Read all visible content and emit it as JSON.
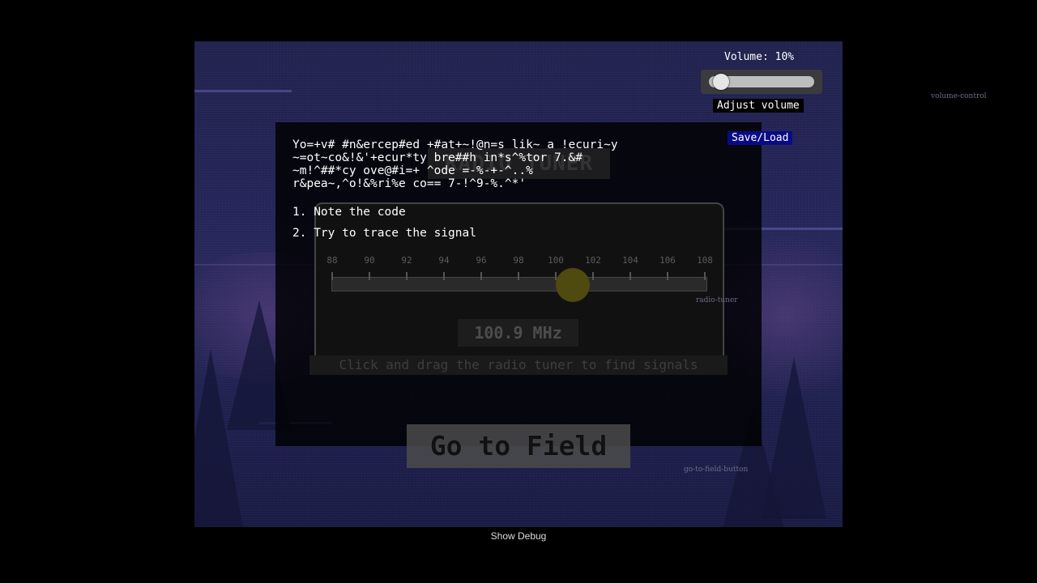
{
  "volume": {
    "label": "Volume: 10%",
    "level_percent": 10,
    "adjust_label": "Adjust volume",
    "debug_name": "volume-control"
  },
  "menu": {
    "save_load_label": "Save/Load"
  },
  "dialog": {
    "message": "Yo=+v# #n&ercep#ed +#at+~!@n=s lik~ a !ecuri~y\n~=ot~co&!&'+ecur*ty bre##h in*s^%tor 7.&#\n~m!^##*cy ove@#i=+ ^ode =-%-+-^..%\nr&pea~,^o!&%ri%e co== 7-!^9-%.^*'",
    "choices": [
      "1. Note the code",
      "2. Try to trace the signal"
    ]
  },
  "tuner": {
    "title": "RADIO TUNER",
    "tick_labels": [
      "88",
      "90",
      "92",
      "94",
      "96",
      "98",
      "100",
      "102",
      "104",
      "106",
      "108"
    ],
    "min_mhz": 88,
    "max_mhz": 108,
    "frequency_mhz": 100.9,
    "frequency_display": "100.9 MHz",
    "instruction": "Click and drag the radio tuner to find signals",
    "debug_name": "radio-tuner"
  },
  "field_button": {
    "label": "Go to Field",
    "debug_name": "go-to-field-button"
  },
  "debug_toggle": {
    "label": "Show Debug"
  },
  "colors": {
    "background": "#000000",
    "scene": "#25265a",
    "save_load_bg": "#0a0a86",
    "knob": "#4f4a10"
  }
}
